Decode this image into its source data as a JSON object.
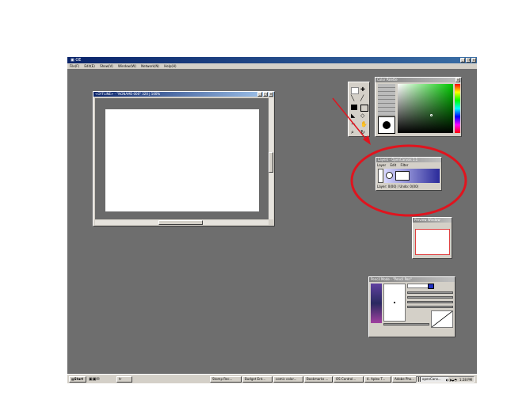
{
  "app": {
    "title": "OE",
    "menu": [
      "File(F)",
      "Edit(E)",
      "Show(V)",
      "Window(W)",
      "Network(N)",
      "Help(H)"
    ]
  },
  "canvas_window": {
    "title": "<OFFLINE> - \"NONAME-000\" 320 | 100%"
  },
  "color_window": {
    "title": "Color Palette"
  },
  "layer_window": {
    "title": "Layers - OpenCanvas 1.1",
    "menu": [
      "Layer",
      "Edit",
      "Filter"
    ],
    "status": "Layer: 0(00) / Undo: 0(00)"
  },
  "preview_window": {
    "title": "Preview Window"
  },
  "brush_window": {
    "title": "Pencil Mode - \"Pencil Pen\""
  },
  "taskbar": {
    "start": "Start",
    "items": [
      "tr",
      "Stomp Rec...",
      "Budget Ent...",
      "comic color...",
      "Bookmarks ...",
      "OS Control...",
      "4. Aplex T...",
      "Adobe Pho...",
      "openCanv..."
    ],
    "clock": "1:28 PM"
  },
  "colors": {
    "desktop": "#6e6e6e",
    "annotation": "#e0141e",
    "titlebar": "#0a246a"
  }
}
